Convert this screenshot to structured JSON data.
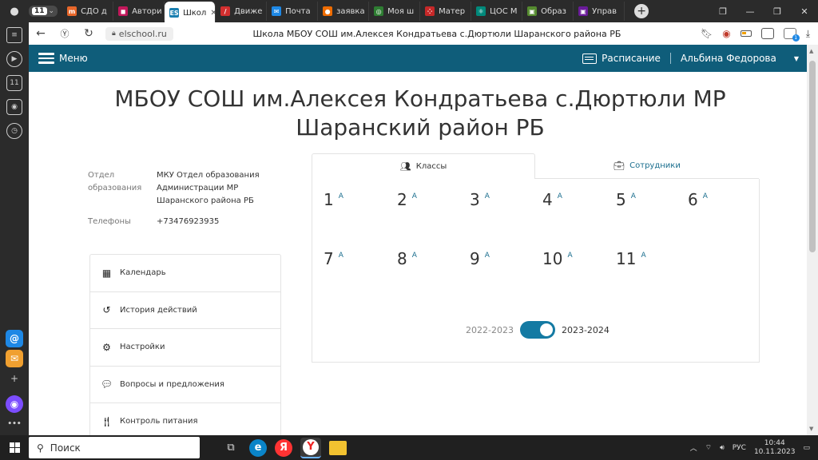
{
  "browser": {
    "tab_count": "11",
    "tabs": [
      {
        "label": "СДО д",
        "color": "#e8672a",
        "glyph": "m"
      },
      {
        "label": "Автори",
        "color": "#c2185b",
        "glyph": "◼"
      },
      {
        "label": "Школ",
        "color": "#1a7fb0",
        "glyph": "ES",
        "active": true
      },
      {
        "label": "Движе",
        "color": "#d32f2f",
        "glyph": "/"
      },
      {
        "label": "Почта",
        "color": "#1e88e5",
        "glyph": "✉"
      },
      {
        "label": "заявка",
        "color": "#ef6c00",
        "glyph": "●"
      },
      {
        "label": "Моя ш",
        "color": "#2e7d32",
        "glyph": "◎"
      },
      {
        "label": "Матер",
        "color": "#c62828",
        "glyph": "⁘"
      },
      {
        "label": "ЦОС М",
        "color": "#00897b",
        "glyph": "⚛"
      },
      {
        "label": "Образ",
        "color": "#558b2f",
        "glyph": "▣"
      },
      {
        "label": "Управ",
        "color": "#6a1b9a",
        "glyph": "▣"
      }
    ],
    "url": "elschool.ru",
    "page_title": "Школа МБОУ СОШ им.Алексея Кондратьева с.Дюртюли Шаранского района РБ",
    "rail_counter": "11",
    "ext_badge": "1"
  },
  "site": {
    "menu_label": "Меню",
    "schedule_label": "Расписание",
    "user_name": "Альбина Федорова",
    "school_name": "МБОУ СОШ им.Алексея Кондратьева с.Дюртюли МР Шаранский район РБ",
    "info": {
      "dept_label": "Отдел образования",
      "dept_value": "МКУ Отдел образования Администрации МР Шаранского района РБ",
      "phone_label": "Телефоны",
      "phone_value": "+73476923935"
    },
    "side_menu": [
      {
        "label": "Календарь",
        "icon": "calendar-icon"
      },
      {
        "label": "История действий",
        "icon": "history-icon"
      },
      {
        "label": "Настройки",
        "icon": "gear-icon"
      },
      {
        "label": "Вопросы и предложения",
        "icon": "chat-icon"
      },
      {
        "label": "Контроль питания",
        "icon": "cutlery-icon"
      }
    ],
    "tabs": {
      "classes": "Классы",
      "staff": "Сотрудники"
    },
    "grades": [
      {
        "num": "1",
        "letter": "А"
      },
      {
        "num": "2",
        "letter": "А"
      },
      {
        "num": "3",
        "letter": "А"
      },
      {
        "num": "4",
        "letter": "А"
      },
      {
        "num": "5",
        "letter": "А"
      },
      {
        "num": "6",
        "letter": "А"
      },
      {
        "num": "7",
        "letter": "А"
      },
      {
        "num": "8",
        "letter": "А"
      },
      {
        "num": "9",
        "letter": "А"
      },
      {
        "num": "10",
        "letter": "А"
      },
      {
        "num": "11",
        "letter": "А"
      }
    ],
    "year_prev": "2022-2023",
    "year_current": "2023-2024"
  },
  "taskbar": {
    "search_placeholder": "Поиск",
    "lang": "РУС",
    "time": "10:44",
    "date": "10.11.2023"
  }
}
